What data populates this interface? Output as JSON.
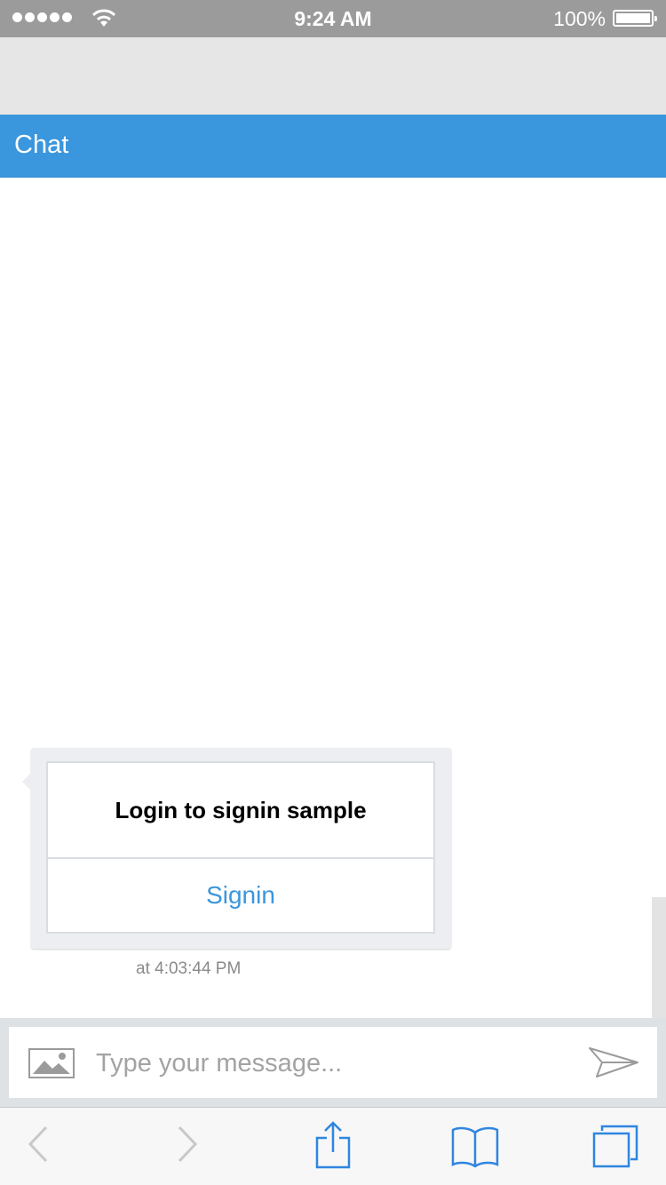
{
  "status_bar": {
    "time": "9:24 AM",
    "battery": "100%"
  },
  "header": {
    "title": "Chat"
  },
  "message": {
    "card_title": "Login to signin sample",
    "button_label": "Signin",
    "timestamp": "at 4:03:44 PM"
  },
  "composer": {
    "placeholder": "Type your message...",
    "attach_icon": "image-icon",
    "send_icon": "send-icon"
  },
  "toolbar": {
    "icons": [
      "back-icon",
      "forward-icon",
      "share-icon",
      "bookmarks-icon",
      "tabs-icon"
    ]
  },
  "colors": {
    "accent": "#3a96dd",
    "status_bar": "#9b9b9b"
  }
}
